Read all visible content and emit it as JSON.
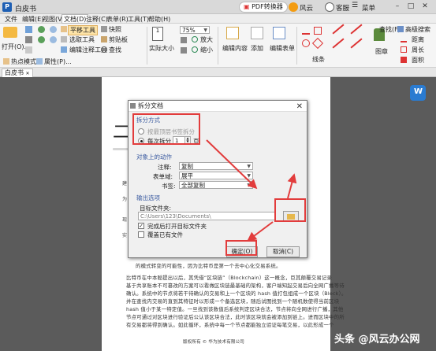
{
  "app": {
    "logo_letter": "P",
    "doc_name": "白皮书",
    "pdf_tool": "PDF转换器",
    "user": "风云",
    "service": "客服",
    "settings": "菜单"
  },
  "menu": [
    "文件",
    "编辑(E)",
    "视图(V)",
    "文档(D)",
    "注释(C)",
    "表单(R)",
    "工具(T)",
    "帮助(H)"
  ],
  "ribbon": {
    "open": "打开(O)...",
    "hand": "平移工具",
    "select_text": "选取工具",
    "edit_content": "编辑注释工具",
    "snapshot": "快照",
    "clipboard": "剪贴板",
    "find": "查找",
    "actual_size": "实际大小",
    "zoom_value": "75%",
    "zoom_in": "放大",
    "zoom_out": "缩小",
    "edit_content2": "编辑内容",
    "add": "添加",
    "edit_form": "编辑表单",
    "line": "线条",
    "stamp": "图章",
    "find_right": "查找(F)",
    "adv_search": "高级搜索",
    "distance": "距离",
    "perimeter": "周长",
    "area": "面积",
    "hotspot": "热点模式",
    "properties": "属性(P)..."
  },
  "tab": {
    "label": "白皮书"
  },
  "document": {
    "heading_char": "二",
    "side_chars": [
      "建",
      "为",
      "现",
      "实"
    ],
    "lines": [
      "比特币在中本聪提出以后，其凭借“区块链”（Blockchain）这一概念，巨其颠覆交易记录",
      "基于共享账本不可篡改的方案可以看做区块链最基础的架构，客户端知起交易后向全网广播等待",
      "确认。系统中的节点将若干待确认的交易和上一个区块的 hash 值打包组成一个区块（Block）。",
      "并在查找内交易的直到其特征时以形成一个备选区块，随后试图找到一个随机数使得当前区块",
      "hash 值小于某一特定值。一旦找到该数值后系统判定区块合法，节点将向全网进行广播，其他",
      "节点可通过对区块进行验证后公认该区块合法，此时该区块就会被添加到链上。进而区块中的所",
      "有交易都将得到确认。如此循环，系统中每一个节点都能独立验证每笔交易，以此形成一个"
    ],
    "para_prefix": "的模式转变的可能性，因为比特币是第一个去中心化交易系统。",
    "footer": "版权所有 © 华为技术有限公司"
  },
  "dialog": {
    "title": "拆分文档",
    "section_split": "拆分方式",
    "opt_bookmark": "按最顶层书签拆分",
    "opt_pages": "每次拆分",
    "pages_value": "1",
    "pages_unit": "页",
    "section_object": "对象上的动作",
    "annot_label": "注释:",
    "annot_value": "复制",
    "form_label": "表单域:",
    "form_value": "展平",
    "bookmark_label": "书签:",
    "bookmark_value": "全部复制",
    "section_output": "输出选项",
    "target_label": "目标文件夹:",
    "target_value": "C:\\Users\\123\\Documents\\",
    "open_after": "完成后打开目标文件夹",
    "overwrite": "覆盖已有文件",
    "ok": "确定(O)",
    "cancel": "取消(C)"
  },
  "watermark": "头条 @风云办公网"
}
